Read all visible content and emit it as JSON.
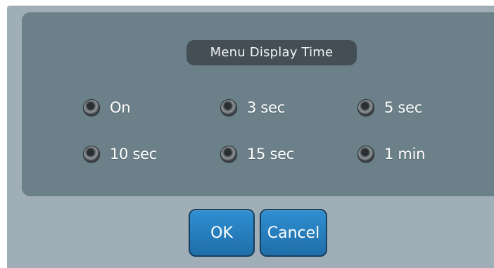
{
  "dialog": {
    "title": "Menu Display Time",
    "options": [
      {
        "label": "On"
      },
      {
        "label": "3 sec"
      },
      {
        "label": "5 sec"
      },
      {
        "label": "10 sec"
      },
      {
        "label": "15 sec"
      },
      {
        "label": "1 min"
      }
    ],
    "buttons": {
      "ok_label": "OK",
      "cancel_label": "Cancel"
    }
  },
  "colors": {
    "dialog_background": "#a0afb7",
    "panel_background": "#6b8088",
    "title_pill": "#434f55",
    "button_blue": "#2f8fd2"
  },
  "icons": {
    "option_marker": "radio-icon"
  }
}
